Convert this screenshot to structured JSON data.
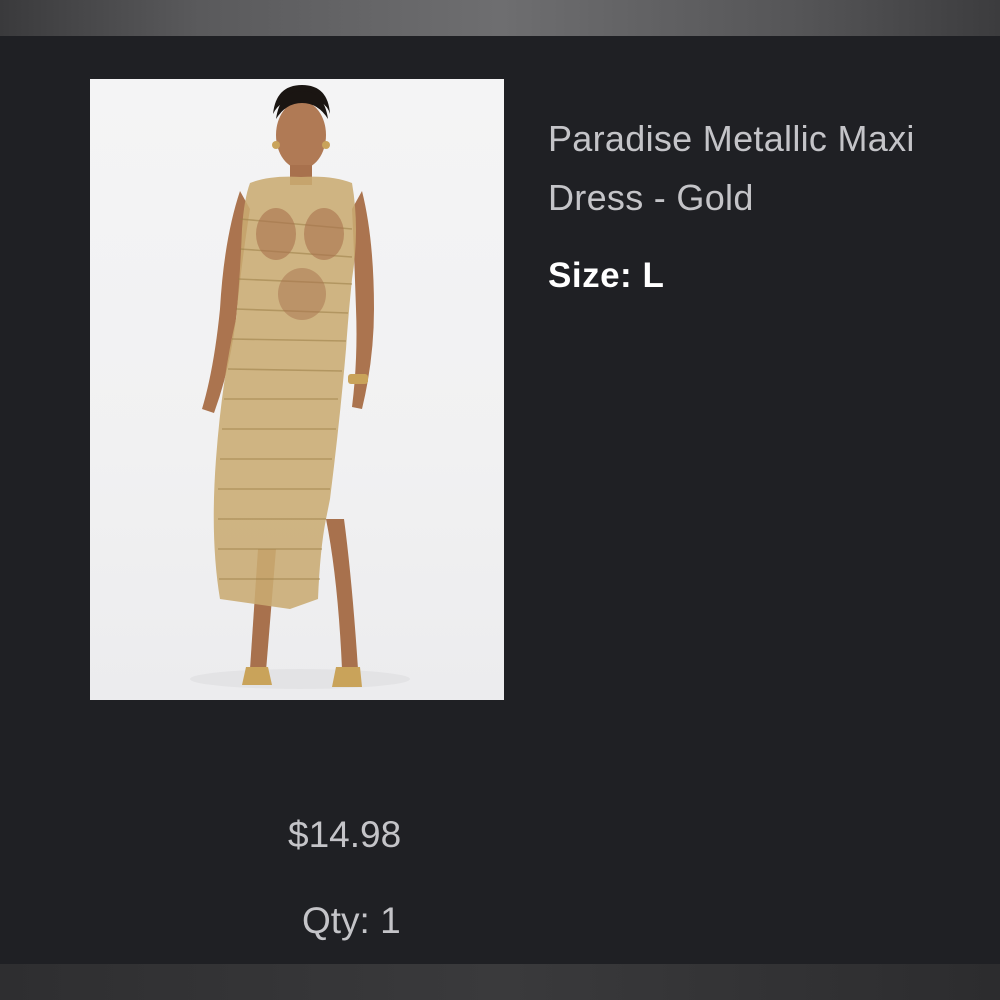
{
  "product": {
    "title": "Paradise Metallic Maxi Dress - Gold",
    "size_label": "Size:",
    "size_value": "L",
    "price": "$14.98",
    "qty_label": "Qty:",
    "qty_value": "1",
    "image_icon": "product-photo"
  },
  "colors": {
    "background": "#1f2024",
    "title_text": "#c4c4c8",
    "size_text": "#ffffff",
    "dress_gold": "#c9ab72"
  }
}
